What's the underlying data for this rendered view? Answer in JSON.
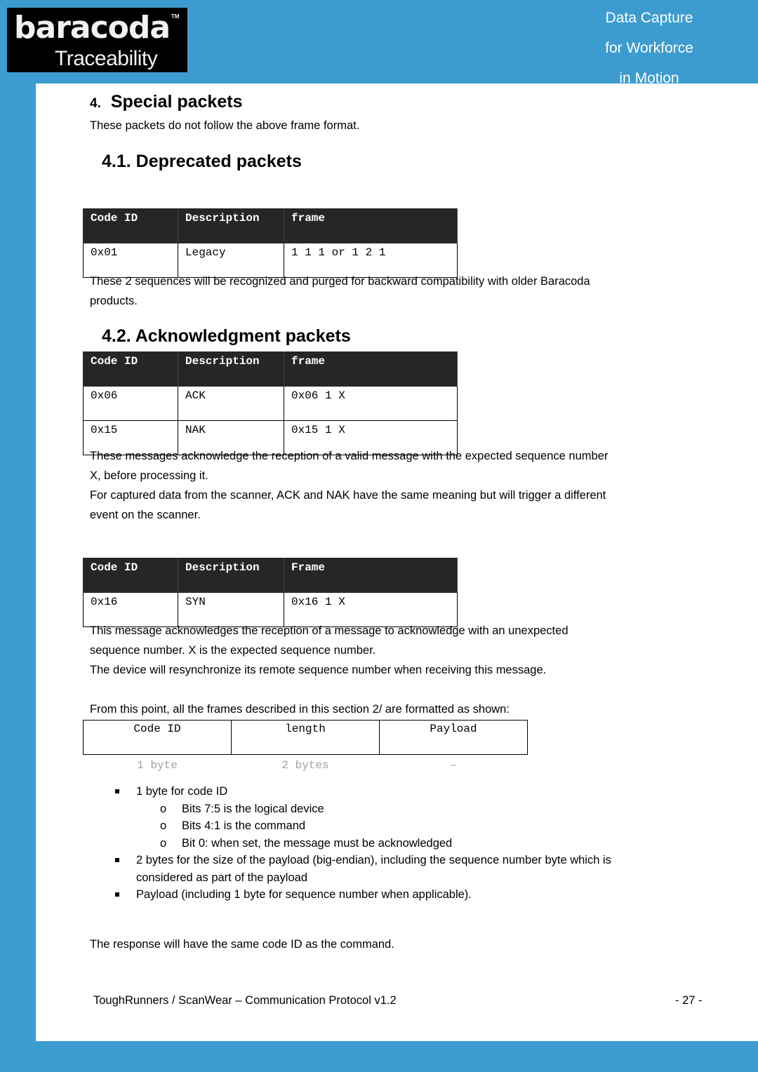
{
  "header": {
    "logo": {
      "brand": "baracoda",
      "trademark": "TM",
      "sub": "Traceability"
    },
    "tagline": [
      "Data Capture",
      "for Workforce",
      "in Motion"
    ]
  },
  "section": {
    "number": "4.",
    "title": "Special packets",
    "intro": "These packets do not follow the above frame format."
  },
  "deprecated": {
    "heading": "4.1. Deprecated packets",
    "table": {
      "headers": [
        "Code ID",
        "Description",
        "frame"
      ],
      "rows": [
        [
          "0x01",
          "Legacy",
          "1 1 1 or 1 2 1"
        ]
      ]
    },
    "note_line1": "These 2 sequences will be recognized and purged for backward compatibility with older Baracoda",
    "note_line2": "products."
  },
  "ack": {
    "heading": "4.2. Acknowledgment packets",
    "table": {
      "headers": [
        "Code ID",
        "Description",
        "frame"
      ],
      "rows": [
        [
          "0x06",
          "ACK",
          "0x06 1 X"
        ],
        [
          "0x15",
          "NAK",
          "0x15 1 X"
        ]
      ]
    },
    "para1_line1": "These messages acknowledge the reception of a valid message with the expected sequence number",
    "para1_line2": "X, before processing it.",
    "para2_line1": "For captured data from the scanner, ACK and NAK have the same meaning but will trigger a different",
    "para2_line2": "event on the scanner."
  },
  "syn": {
    "table": {
      "headers": [
        "Code ID",
        "Description",
        "Frame"
      ],
      "rows": [
        [
          "0x16",
          "SYN",
          "0x16 1 X"
        ]
      ]
    },
    "para1_line1": "This message acknowledges the reception of a message to acknowledge with an unexpected",
    "para1_line2": "sequence number. X is the expected sequence number.",
    "para2": "The device will resynchronize its remote sequence number when receiving this message."
  },
  "format": {
    "intro": "From this point, all the frames described in this section 2/ are formatted as shown:",
    "fields": [
      "Code ID",
      "length",
      "Payload"
    ],
    "sizes": [
      "1 byte",
      "2 bytes",
      "–"
    ],
    "bullets": [
      {
        "text": "1 byte for code ID",
        "sub": [
          "Bits 7:5 is the logical device",
          "Bits 4:1 is the command",
          "Bit 0: when set, the message must be acknowledged"
        ]
      },
      {
        "text_line1": "2 bytes for the size of the payload (big-endian), including the sequence number byte which is",
        "text_line2": "considered as part of the payload"
      },
      {
        "text": "Payload (including 1 byte for sequence number when applicable)."
      }
    ],
    "sub_bullet_glyph": "o",
    "response": "The response will have the same code ID as the command."
  },
  "footer": {
    "document": "ToughRunners / ScanWear – Communication Protocol v1.2",
    "page": "- 27 -"
  }
}
